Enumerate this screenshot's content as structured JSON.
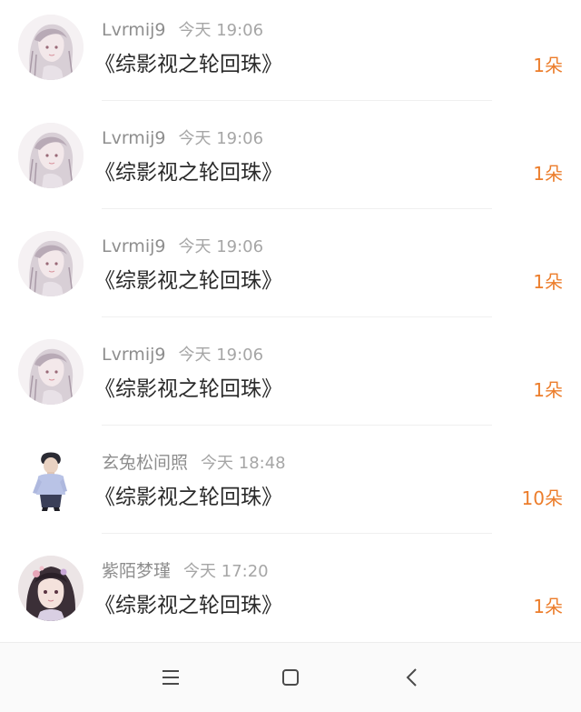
{
  "records": [
    {
      "username": "Lvrmij9",
      "time": "今天 19:06",
      "book": "《综影视之轮回珠》",
      "amount": "1朵",
      "avatar": "anime-girl-avatar"
    },
    {
      "username": "Lvrmij9",
      "time": "今天 19:06",
      "book": "《综影视之轮回珠》",
      "amount": "1朵",
      "avatar": "anime-girl-avatar"
    },
    {
      "username": "Lvrmij9",
      "time": "今天 19:06",
      "book": "《综影视之轮回珠》",
      "amount": "1朵",
      "avatar": "anime-girl-avatar"
    },
    {
      "username": "Lvrmij9",
      "time": "今天 19:06",
      "book": "《综影视之轮回珠》",
      "amount": "1朵",
      "avatar": "anime-girl-avatar"
    },
    {
      "username": "玄兔松间照",
      "time": "今天 18:48",
      "book": "《综影视之轮回珠》",
      "amount": "10朵",
      "avatar": "man-standing-avatar"
    },
    {
      "username": "紫陌梦瑾",
      "time": "今天 17:20",
      "book": "《综影视之轮回珠》",
      "amount": "1朵",
      "avatar": "anime-portrait-avatar"
    }
  ],
  "colors": {
    "amount": "#ec7d2b",
    "username": "#8e8e8e",
    "title": "#2a2a2a"
  },
  "navbar": {
    "menu_icon": "menu-icon",
    "home_icon": "home-square-icon",
    "back_icon": "back-chevron-icon"
  }
}
